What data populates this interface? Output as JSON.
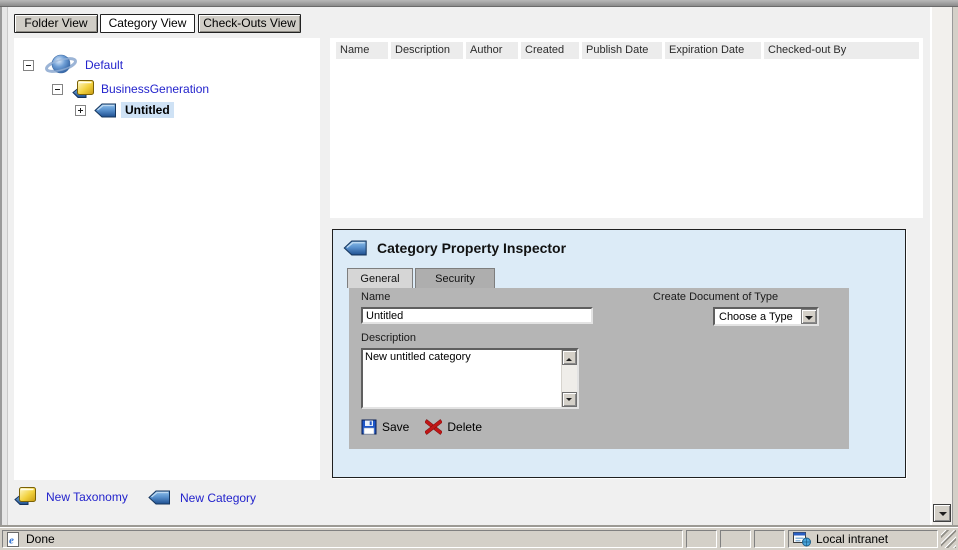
{
  "view_tabs": {
    "folder": "Folder View",
    "category": "Category View",
    "checkouts": "Check-Outs View"
  },
  "tree": {
    "items": [
      {
        "label": "Default",
        "icon": "planet-icon",
        "expander": "minus"
      },
      {
        "label": "BusinessGeneration",
        "icon": "taxonomy-icon",
        "expander": "minus"
      },
      {
        "label": "Untitled",
        "icon": "category-icon",
        "expander": "plus",
        "selected": true
      }
    ]
  },
  "table": {
    "columns": [
      "Name",
      "Description",
      "Author",
      "Created",
      "Publish Date",
      "Expiration Date",
      "Checked-out By"
    ]
  },
  "inspector": {
    "title": "Category Property Inspector",
    "title_icon": "category-icon",
    "tabs": {
      "general": "General",
      "security": "Security"
    },
    "name_label": "Name",
    "name_value": "Untitled",
    "create_doc_label": "Create Document of Type",
    "type_dropdown_value": "Choose a Type",
    "description_label": "Description",
    "description_value": "New untitled category",
    "save_label": "Save",
    "delete_label": "Delete",
    "save_icon": "floppy-disk-icon",
    "delete_icon": "red-x-icon"
  },
  "footer_links": {
    "new_taxonomy": "New Taxonomy",
    "new_category": "New Category"
  },
  "status_bar": {
    "status_text": "Done",
    "zone_text": "Local intranet",
    "browser_icon": "ie-page-icon",
    "zone_icon": "intranet-icon"
  },
  "colors": {
    "link_blue": "#2323cc",
    "inspector_bg": "#dcebf7",
    "form_gray": "#b5b5b5",
    "selection_bg": "#cfe2f5",
    "tag_blue": "#2a62a8",
    "chrome_gray": "#d4d0c8"
  }
}
